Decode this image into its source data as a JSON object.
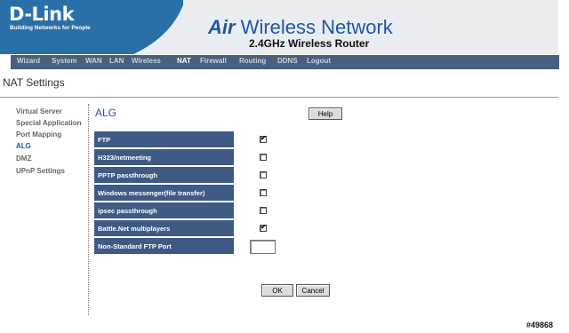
{
  "header": {
    "logo": "D-Link",
    "tagline": "Building Networks for People",
    "brand_air": "Air",
    "brand_rest": " Wireless Network",
    "product": "2.4GHz Wireless Router"
  },
  "nav": [
    {
      "label": "Wizard"
    },
    {
      "label": "System"
    },
    {
      "label": "WAN"
    },
    {
      "label": "LAN"
    },
    {
      "label": "Wireless"
    },
    {
      "label": "NAT",
      "active": true
    },
    {
      "label": "Firewall"
    },
    {
      "label": "Routing"
    },
    {
      "label": "DDNS"
    },
    {
      "label": "Logout"
    }
  ],
  "page_title": "NAT Settings",
  "sidemenu": [
    {
      "label": "Virtual Server"
    },
    {
      "label": "Special Application"
    },
    {
      "label": "Port Mapping"
    },
    {
      "label": "ALG",
      "active": true
    },
    {
      "label": "DMZ"
    },
    {
      "label": "UPnP Settings"
    }
  ],
  "section_title": "ALG",
  "help_label": "Help",
  "rows": [
    {
      "label": "FTP",
      "checked": true
    },
    {
      "label": "H323/netmeeting",
      "checked": false
    },
    {
      "label": "PPTP passthrough",
      "checked": false
    },
    {
      "label": "Windows messenger(file transfer)",
      "checked": false
    },
    {
      "label": "ipsec passthrough",
      "checked": false
    },
    {
      "label": "Battle.Net multiplayers",
      "checked": true
    }
  ],
  "ftp_port": {
    "label": "Non-Standard FTP Port",
    "value": ""
  },
  "ok_label": "OK",
  "cancel_label": "Cancel",
  "watermark": "#49868",
  "colors": {
    "header_blue": "#2a70a8",
    "nav_bg": "#46607f",
    "table_row": "#3f5a84",
    "accent_text": "#1f57a5"
  },
  "icons": {
    "checkmark": "check-icon"
  }
}
